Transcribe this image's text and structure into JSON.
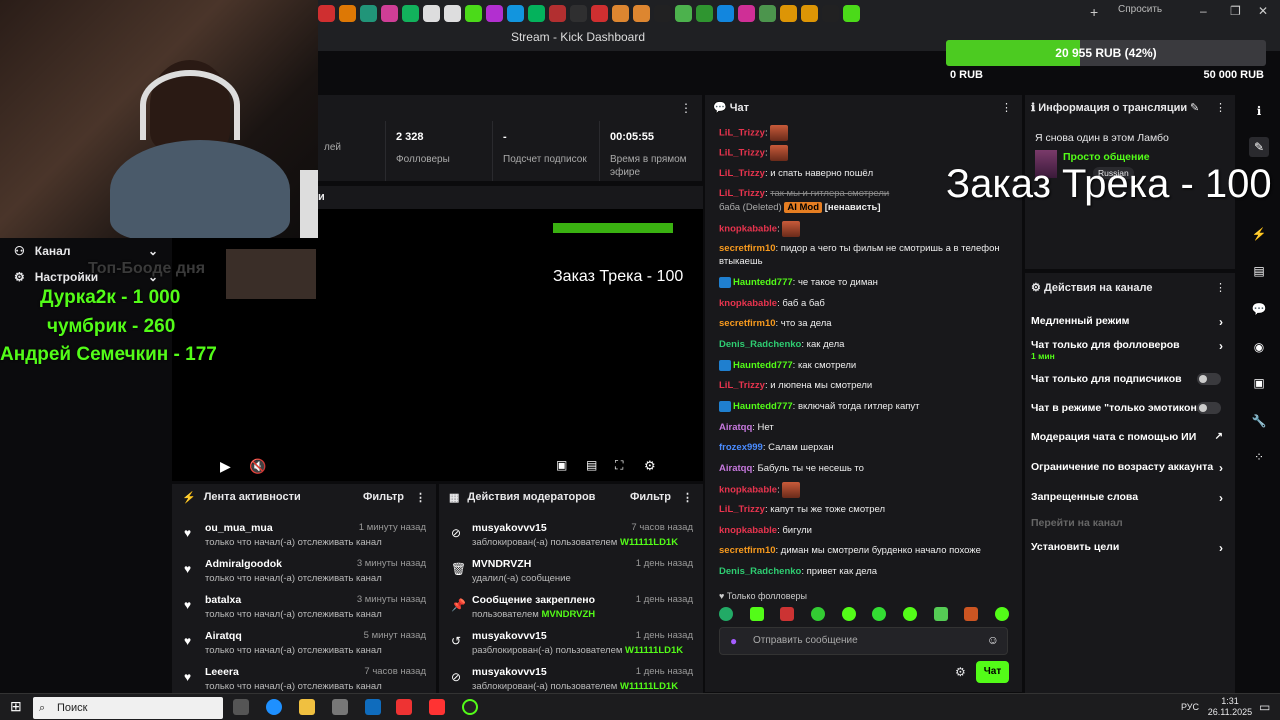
{
  "window": {
    "title": "Stream - Kick Dashboard"
  },
  "goal": {
    "text": "20 955 RUB (42%)",
    "progress": 0.42,
    "min_label": "0 RUB",
    "max_label": "50 000 RUB"
  },
  "browser": {
    "ask_label": "Спросить"
  },
  "left_panel": {
    "channel_label": "Канал",
    "settings_label": "Настройки",
    "ticker": [
      "Дурка2к - 1 000",
      "чумбрик - 260",
      "Андрей Семечкин - 177"
    ],
    "ticker_faded": "Топ-Бооде дня"
  },
  "stats": [
    {
      "value": "",
      "label": "лей"
    },
    {
      "value": "2 328",
      "label": "Фолловеры"
    },
    {
      "value": "-",
      "label": "Подсчет подписок"
    },
    {
      "value": "00:05:55",
      "label": "Время в прямом эфире"
    }
  ],
  "player": {
    "bar_label": "и",
    "preview_text": "Заказ Трека - 100"
  },
  "activity": {
    "title": "Лента активности",
    "filter": "Фильтр",
    "items": [
      {
        "name": "ou_mua_mua",
        "time": "1 минуту назад",
        "text": "только что начал(-а) отслеживать канал"
      },
      {
        "name": "Admiralgoodok",
        "time": "3 минуты назад",
        "text": "только что начал(-а) отслеживать канал"
      },
      {
        "name": "batalxa",
        "time": "3 минуты назад",
        "text": "только что начал(-а) отслеживать канал"
      },
      {
        "name": "Airatqq",
        "time": "5 минут назад",
        "text": "только что начал(-а) отслеживать канал"
      },
      {
        "name": "Leeera",
        "time": "7 часов назад",
        "text": "только что начал(-а) отслеживать канал"
      }
    ]
  },
  "mod_actions": {
    "title": "Действия модераторов",
    "filter": "Фильтр",
    "items": [
      {
        "name": "musyakovvv15",
        "time": "7 часов назад",
        "text": "заблокирован(-а) пользователем",
        "who": "W11111LD1K"
      },
      {
        "name": "MVNDRVZH",
        "time": "1 день назад",
        "text": "удалил(-а) сообщение",
        "who": ""
      },
      {
        "name": "Сообщение закреплено",
        "time": "1 день назад",
        "text": "пользователем",
        "who": "MVNDRVZH"
      },
      {
        "name": "musyakovvv15",
        "time": "1 день назад",
        "text": "разблокирован(-а) пользователем",
        "who": "W11111LD1K"
      },
      {
        "name": "musyakovvv15",
        "time": "1 день назад",
        "text": "заблокирован(-а) пользователем",
        "who": "W11111LD1K"
      }
    ]
  },
  "chat": {
    "title": "Чат",
    "messages": [
      {
        "user": "LiL_Trizzy",
        "color": "#e8344e",
        "text": "",
        "emote": true
      },
      {
        "user": "LiL_Trizzy",
        "color": "#e8344e",
        "text": "",
        "emote": true
      },
      {
        "user": "LiL_Trizzy",
        "color": "#e8344e",
        "text": "и спать наверно пошёл"
      },
      {
        "user": "LiL_Trizzy",
        "color": "#e8344e",
        "text": "так мы и гитлера смотрели",
        "strike": true
      },
      {
        "user": "",
        "color": "#aaa",
        "text": "баба (Deleted)",
        "mod": "AI Mod",
        "extra": "[ненависть]"
      },
      {
        "user": "knopkabable",
        "color": "#e8344e",
        "text": "",
        "emote": true
      },
      {
        "user": "secretfirm10",
        "color": "#f79a1e",
        "text": "пидор а чего ты фильм не смотришь а в телефон втыкаешь"
      },
      {
        "user": "Hauntedd777",
        "color": "#53fc18",
        "text": "че такое то диман",
        "badge": true
      },
      {
        "user": "knopkabable",
        "color": "#e8344e",
        "text": "баб а баб"
      },
      {
        "user": "secretfirm10",
        "color": "#f79a1e",
        "text": "что за дела"
      },
      {
        "user": "Denis_Radchenko",
        "color": "#2ecc71",
        "text": "как дела"
      },
      {
        "user": "Hauntedd777",
        "color": "#53fc18",
        "text": "как смотрели",
        "badge": true
      },
      {
        "user": "LiL_Trizzy",
        "color": "#e8344e",
        "text": "и люпена мы смотрели"
      },
      {
        "user": "Hauntedd777",
        "color": "#53fc18",
        "text": "включай тогда гитлер капут",
        "badge": true
      },
      {
        "user": "Airatqq",
        "color": "#c678dd",
        "text": "Нет"
      },
      {
        "user": "frozex999",
        "color": "#4a8cff",
        "text": "Салам шерхан"
      },
      {
        "user": "Airatqq",
        "color": "#c678dd",
        "text": "Бабуль ты че несешь то"
      },
      {
        "user": "knopkabable",
        "color": "#e8344e",
        "text": "",
        "emote": true
      },
      {
        "user": "LiL_Trizzy",
        "color": "#e8344e",
        "text": "капут ты же тоже смотрел"
      },
      {
        "user": "knopkabable",
        "color": "#e8344e",
        "text": "бигули"
      },
      {
        "user": "secretfirm10",
        "color": "#f79a1e",
        "text": "диман мы смотрели бурденко начало похоже"
      },
      {
        "user": "Denis_Radchenko",
        "color": "#2ecc71",
        "text": "привет как дела"
      }
    ],
    "mode_label": "Только фолловеры",
    "input_placeholder": "Отправить сообщение",
    "send_label": "Чат"
  },
  "stream_info": {
    "title": "Информация о трансляции",
    "stream_title": "Я снова один в этом Ламбо",
    "category": "Просто общение",
    "tag": "Russian"
  },
  "channel_actions": {
    "title": "Действия на канале",
    "items": [
      {
        "label": "Медленный режим",
        "kind": "chevron"
      },
      {
        "label": "Чат только для фолловеров",
        "sub": "1 мин",
        "kind": "chevron"
      },
      {
        "label": "Чат только для подписчиков",
        "kind": "toggle"
      },
      {
        "label": "Чат в режиме \"только эмотиконы\"",
        "kind": "toggle"
      },
      {
        "label": "Модерация чата с помощью ИИ",
        "kind": "external"
      },
      {
        "label": "Ограничение по возрасту аккаунта",
        "kind": "chevron"
      },
      {
        "label": "Запрещенные слова",
        "kind": "chevron"
      },
      {
        "label": "Перейти на канал",
        "kind": "disabled"
      },
      {
        "label": "Установить цели",
        "kind": "chevron"
      }
    ]
  },
  "overlay": {
    "order_text": "Заказ Трека - 100"
  },
  "taskbar": {
    "search": "Поиск",
    "lang": "РУС",
    "time": "1:31",
    "date": "26.11.2025"
  },
  "colors": {
    "accent": "#53fc18",
    "panel": "#18181b",
    "bg": "#0b0b0d"
  }
}
